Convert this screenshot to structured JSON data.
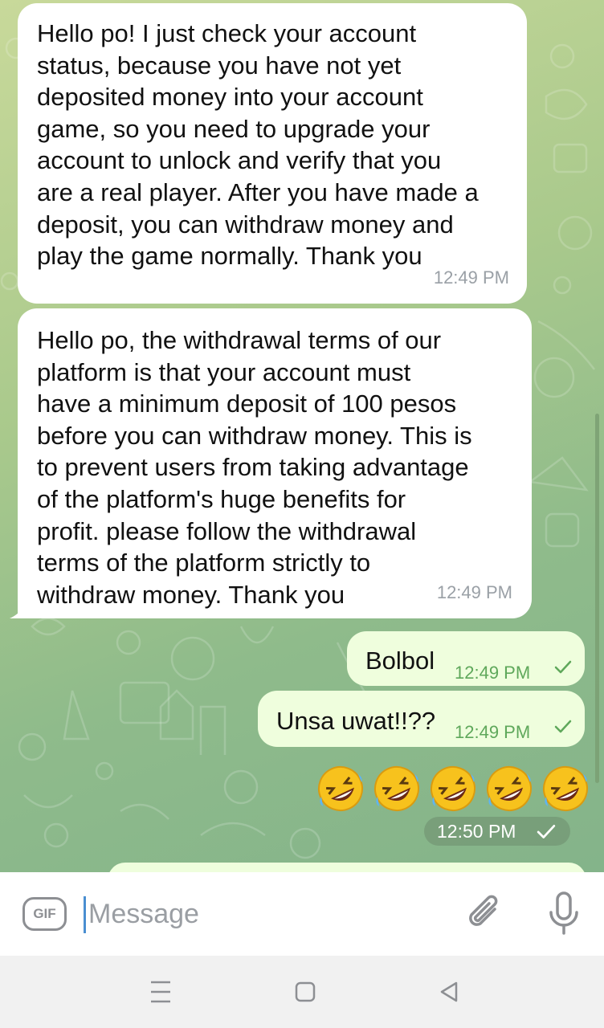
{
  "messages": [
    {
      "direction": "incoming",
      "text": "Hello po! I just check your account\nstatus, because you have not yet\ndeposited money into your account\ngame, so you need to upgrade your\naccount to unlock and verify that you\nare a real player. After you have made a\ndeposit, you can withdraw money and\nplay the game normally. Thank you",
      "time": "12:49 PM"
    },
    {
      "direction": "incoming",
      "text": "Hello po, the withdrawal terms of our\nplatform is that your account must\nhave a minimum deposit of 100 pesos\nbefore you can withdraw money. This is\nto prevent users from taking advantage\nof the platform's huge benefits for\nprofit. please follow the withdrawal\nterms of the platform strictly to\nwithdraw money. Thank you",
      "time": "12:49 PM"
    },
    {
      "direction": "outgoing",
      "text": "Bolbol",
      "time": "12:49 PM",
      "status": "sent"
    },
    {
      "direction": "outgoing",
      "text": "Unsa uwat!!??",
      "time": "12:49 PM",
      "status": "sent"
    },
    {
      "direction": "outgoing",
      "emoji": [
        "🤣",
        "🤣",
        "🤣",
        "🤣",
        "🤣"
      ],
      "time": "12:50 PM",
      "status": "sent"
    }
  ],
  "composer": {
    "gif_label": "GIF",
    "placeholder": "Message",
    "attach_icon": "paperclip-icon",
    "mic_icon": "microphone-icon"
  },
  "navbar": {
    "icons": [
      "menu-icon",
      "home-icon",
      "back-icon"
    ]
  },
  "colors": {
    "incoming_bubble": "#ffffff",
    "outgoing_bubble": "#effedd",
    "outgoing_meta": "#5fa85b",
    "incoming_meta": "#9aa0a6",
    "caret": "#4a8fd1"
  }
}
